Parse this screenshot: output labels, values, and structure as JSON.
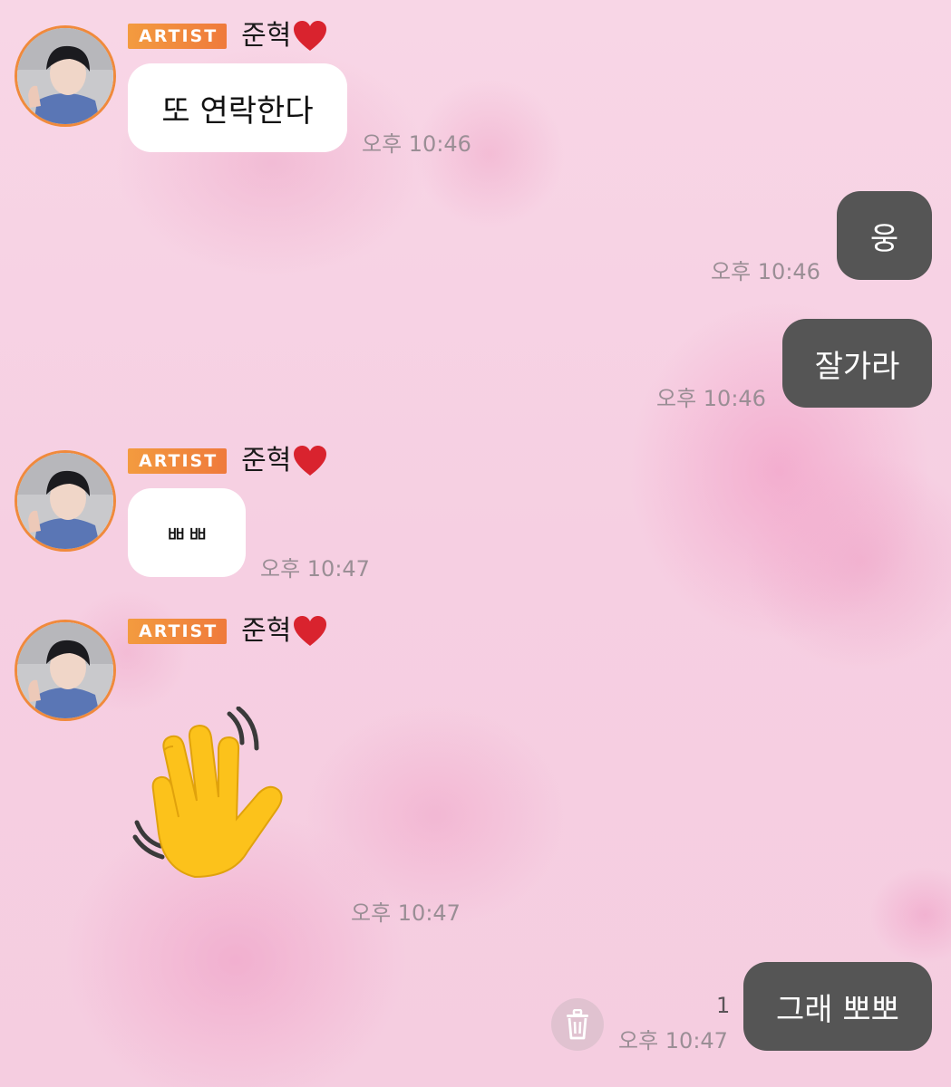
{
  "messages": [
    {
      "sender": {
        "badge": "ARTIST",
        "name": "준혁"
      },
      "text": "또 연락한다",
      "time": "오후 10:46"
    },
    {
      "outgoing": true,
      "text": "웅",
      "time": "오후 10:46"
    },
    {
      "outgoing": true,
      "text": "잘가라",
      "time": "오후 10:46"
    },
    {
      "sender": {
        "badge": "ARTIST",
        "name": "준혁"
      },
      "text": "ㅃㅃ",
      "time": "오후 10:47"
    },
    {
      "sender": {
        "badge": "ARTIST",
        "name": "준혁"
      },
      "emoji": "waving-hand-icon",
      "time": "오후 10:47"
    },
    {
      "outgoing": true,
      "text": "그래 뽀뽀",
      "time": "오후 10:47",
      "unread_count": "1"
    }
  ],
  "colors": {
    "background": "#f6cfe2",
    "badge": "#f08a3c",
    "incoming_bubble": "#ffffff",
    "outgoing_bubble": "#555555",
    "timestamp": "#9a8e95"
  }
}
